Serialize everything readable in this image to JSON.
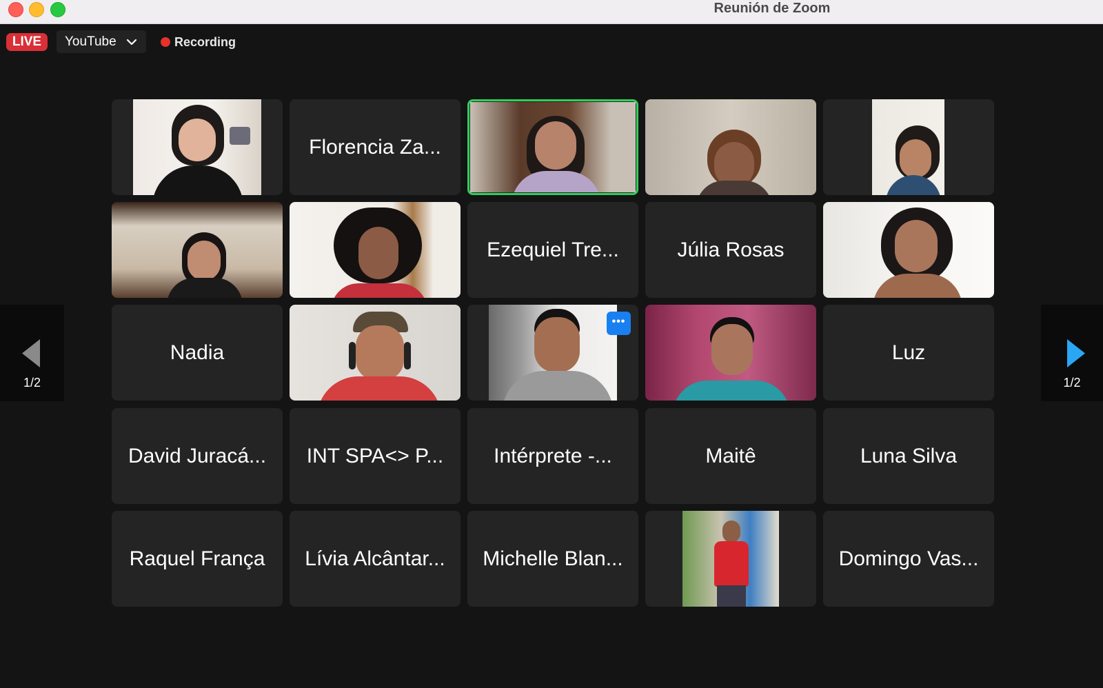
{
  "window": {
    "title": "Reunión de Zoom"
  },
  "toolbar": {
    "live_label": "LIVE",
    "stream_platform": "YouTube",
    "recording_label": "Recording"
  },
  "navigation": {
    "left_page": "1/2",
    "right_page": "1/2"
  },
  "tiles": {
    "t01": "",
    "t02": "Florencia Za...",
    "t03": "",
    "t04": "",
    "t05": "",
    "t06": "",
    "t07": "",
    "t08": "Ezequiel Tre...",
    "t09": "Júlia Rosas",
    "t10": "",
    "t11": "Nadia",
    "t12": "",
    "t13": "",
    "t14": "",
    "t15": "Luz",
    "t16": "David Juracá...",
    "t17": "INT SPA<> P...",
    "t18": "Intérprete -...",
    "t19": "Maitê",
    "t20": "Luna Silva",
    "t21": "Raquel França",
    "t22": "Lívia Alcântar...",
    "t23": "Michelle Blan...",
    "t24": "",
    "t25": "Domingo Vas..."
  },
  "colors": {
    "live": "#d92f36",
    "active_speaker": "#2fd05a",
    "more_button": "#1a7ff0",
    "next_arrow": "#2aa6f5"
  }
}
